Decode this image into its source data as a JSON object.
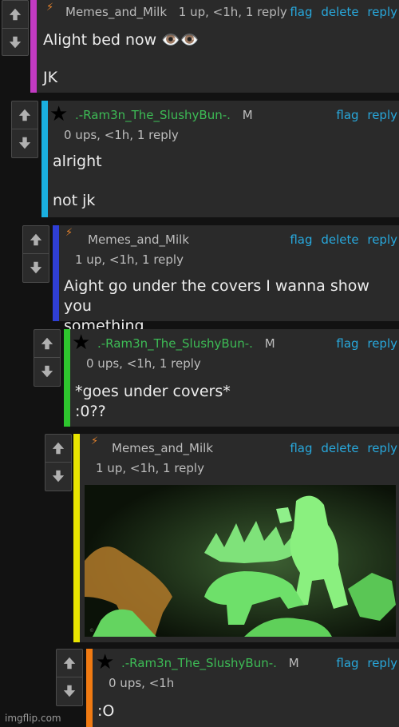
{
  "icons": {
    "up": "up-arrow-icon",
    "down": "down-arrow-icon",
    "bolt": "lightning-icon",
    "star": "star-icon"
  },
  "colors": {
    "magenta": "#c23ac2",
    "cyan": "#1ab0e0",
    "blue": "#2f3fd6",
    "green": "#2ec52e",
    "yellow": "#e8e400",
    "orange": "#f07a12"
  },
  "comments": [
    {
      "username": "Memes_and_Milk",
      "inline_stats": "1 up, <1h, 1 reply",
      "actions": [
        "flag",
        "delete",
        "reply"
      ],
      "lines": [
        "Alight bed now 👁️👁️",
        "JK"
      ]
    },
    {
      "username": ".-Ram3n_The_SlushyBun-.",
      "mod": "M",
      "stats": "0 ups, <1h, 1 reply",
      "actions": [
        "flag",
        "reply"
      ],
      "lines": [
        "alright",
        "not jk"
      ]
    },
    {
      "username": "Memes_and_Milk",
      "stats": "1 up, <1h, 1 reply",
      "actions": [
        "flag",
        "delete",
        "reply"
      ],
      "lines": [
        "Aight go under the covers I wanna show you",
        "something"
      ]
    },
    {
      "username": ".-Ram3n_The_SlushyBun-.",
      "mod": "M",
      "stats": "0 ups, <1h, 1 reply",
      "actions": [
        "flag",
        "reply"
      ],
      "lines": [
        "*goes under covers*",
        ":0??"
      ]
    },
    {
      "username": "Memes_and_Milk",
      "stats": "1 up, <1h, 1 reply",
      "actions": [
        "flag",
        "delete",
        "reply"
      ],
      "lines": []
    },
    {
      "username": ".-Ram3n_The_SlushyBun-.",
      "mod": "M",
      "stats": "0 ups, <1h",
      "actions": [
        "flag",
        "reply"
      ],
      "lines": [
        ":O"
      ]
    }
  ],
  "watermark": "imgflip.com"
}
